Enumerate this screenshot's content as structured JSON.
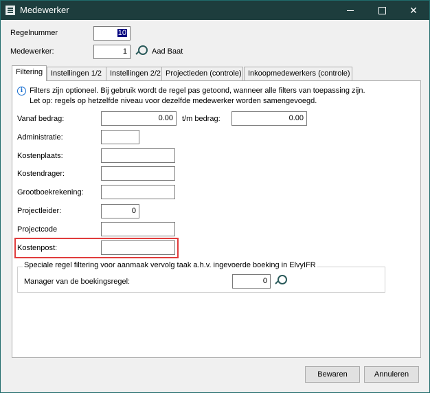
{
  "window": {
    "title": "Medewerker"
  },
  "header": {
    "regelnummer_label": "Regelnummer",
    "regelnummer_value": "10",
    "medewerker_label": "Medewerker:",
    "medewerker_value": "1",
    "medewerker_name": "Aad Baat"
  },
  "tabs": [
    {
      "label": "Filtering",
      "active": true
    },
    {
      "label": "Instellingen 1/2",
      "active": false
    },
    {
      "label": "Instellingen 2/2",
      "active": false
    },
    {
      "label": "Projectleden (controle)",
      "active": false
    },
    {
      "label": "Inkoopmedewerkers (controle)",
      "active": false
    }
  ],
  "info": {
    "line1": "Filters zijn optioneel. Bij gebruik wordt de regel pas getoond, wanneer alle filters van toepassing zijn.",
    "line2": "Let op: regels op hetzelfde niveau voor dezelfde medewerker worden samengevoegd."
  },
  "filters": {
    "vanaf_label": "Vanaf bedrag:",
    "vanaf_value": "0.00",
    "tm_label": "t/m bedrag:",
    "tm_value": "0.00",
    "administratie_label": "Administratie:",
    "administratie_value": "",
    "kostenplaats_label": "Kostenplaats:",
    "kostenplaats_value": "",
    "kostendrager_label": "Kostendrager:",
    "kostendrager_value": "",
    "grootboek_label": "Grootboekrekening:",
    "grootboek_value": "",
    "projectleider_label": "Projectleider:",
    "projectleider_value": "0",
    "projectcode_label": "Projectcode",
    "projectcode_value": "",
    "kostenpost_label": "Kostenpost:",
    "kostenpost_value": ""
  },
  "special": {
    "title": "Speciale regel filtering voor aanmaak vervolg taak a.h.v. ingevoerde boeking in ElvyIFR",
    "manager_label": "Manager van de boekingsregel:",
    "manager_value": "0"
  },
  "buttons": {
    "save": "Bewaren",
    "cancel": "Annuleren"
  },
  "colors": {
    "titlebar": "#1d3d3d",
    "highlight": "#e03c3c",
    "selection": "#000080"
  }
}
